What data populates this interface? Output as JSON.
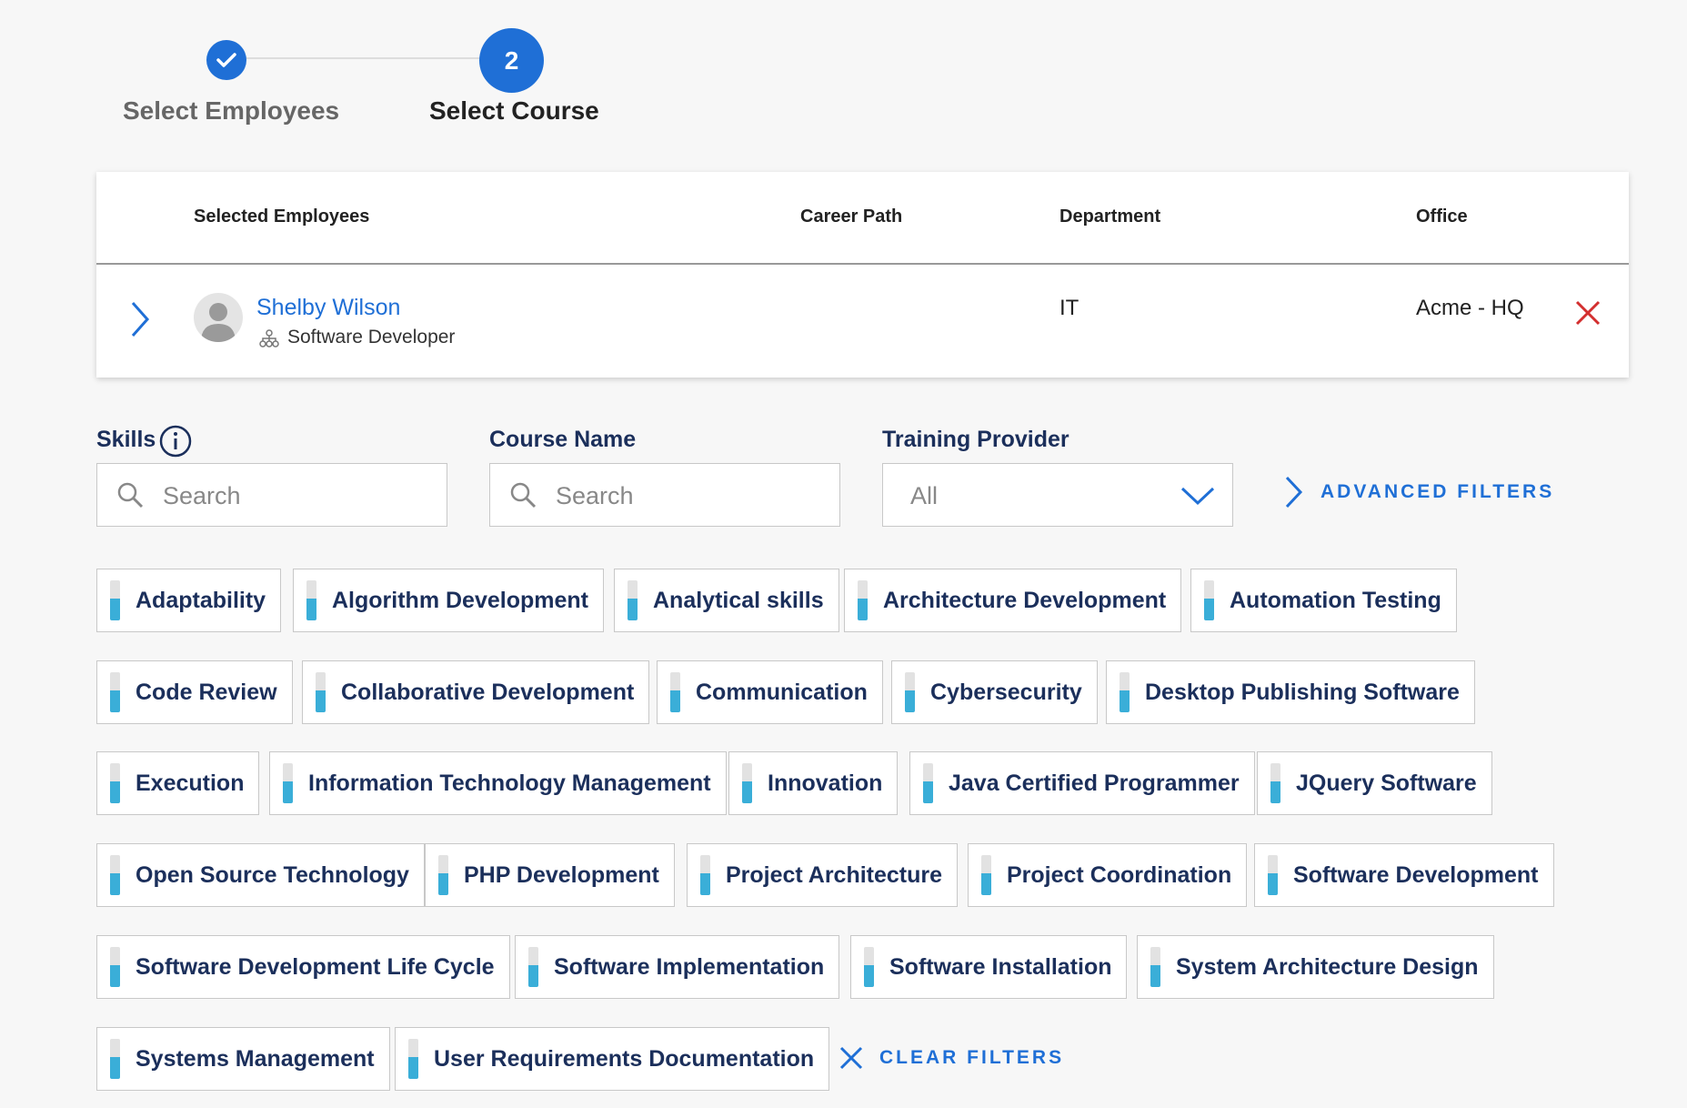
{
  "stepper": {
    "step1_label": "Select Employees",
    "step2_number": "2",
    "step2_label": "Select Course"
  },
  "employees_table": {
    "headers": [
      "Selected Employees",
      "Career Path",
      "Department",
      "Office"
    ],
    "rows": [
      {
        "name": "Shelby Wilson",
        "role": "Software Developer",
        "career_path": "",
        "department": "IT",
        "office": "Acme - HQ"
      }
    ]
  },
  "filters": {
    "skills_label": "Skills",
    "skills_placeholder": "Search",
    "course_label": "Course Name",
    "course_placeholder": "Search",
    "provider_label": "Training Provider",
    "provider_value": "All",
    "advanced_label": "ADVANCED FILTERS"
  },
  "skills": [
    "Adaptability",
    "Algorithm Development",
    "Analytical skills",
    "Architecture Development",
    "Automation Testing",
    "Code Review",
    "Collaborative Development",
    "Communication",
    "Cybersecurity",
    "Desktop Publishing Software",
    "Execution",
    "Information Technology Management",
    "Innovation",
    "Java Certified Programmer",
    "JQuery Software",
    "Open Source Technology",
    "PHP Development",
    "Project Architecture",
    "Project Coordination",
    "Software Development",
    "Software Development Life Cycle",
    "Software Implementation",
    "Software Installation",
    "System Architecture Design",
    "Systems Management",
    "User Requirements Documentation"
  ],
  "clear_filters_label": "CLEAR FILTERS",
  "colors": {
    "accent": "#1f6fd6",
    "navy": "#1b2f5b",
    "remove": "#d32f2f",
    "skill_bar": "#3aaed8"
  }
}
